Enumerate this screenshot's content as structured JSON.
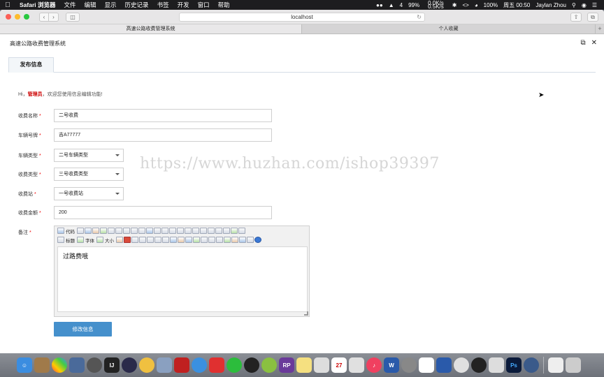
{
  "menubar": {
    "app": "Safari 浏览器",
    "items": [
      "文件",
      "编辑",
      "显示",
      "历史记录",
      "书签",
      "开发",
      "窗口",
      "帮助"
    ],
    "status_badge": "4",
    "battery_ring": "99%",
    "net_up": "0.0K/s",
    "net_down": "0.5K/s",
    "battery": "100%",
    "clock": "周五 00:50",
    "user": "Jaylan Zhou"
  },
  "browser": {
    "url": "localhost",
    "tabs": [
      "高速公路收费管理系统",
      "个人收藏"
    ]
  },
  "page": {
    "system_title": "高速公路收费管理系统",
    "tab_label": "发布信息",
    "greeting": {
      "prefix": "Hi，",
      "role": "管理员",
      "suffix": "，欢迎您使用信息编辑功能!"
    },
    "form": {
      "fee_name": {
        "label": "收费名称",
        "value": "二号收费"
      },
      "plate": {
        "label": "车辆号牌",
        "value": "吉A77777"
      },
      "vehicle_type": {
        "label": "车辆类型",
        "value": "二号车辆类型"
      },
      "fee_type": {
        "label": "收费类型",
        "value": "三号收费类型"
      },
      "station": {
        "label": "收费站",
        "value": "一号收费站"
      },
      "amount": {
        "label": "收费金额",
        "value": "200"
      },
      "remark": {
        "label": "备注",
        "value": "过路费哦"
      },
      "required_mark": "*"
    },
    "editor_toolbar": {
      "code": "代码",
      "title": "标题",
      "font": "字体",
      "size": "大小"
    },
    "submit_label": "修改信息",
    "watermark": "https://www.huzhan.com/ishop39397"
  },
  "colors": {
    "accent": "#4590cc",
    "required": "#e00000",
    "role_highlight": "#cc0000",
    "menubar": "#1d1d1f"
  }
}
